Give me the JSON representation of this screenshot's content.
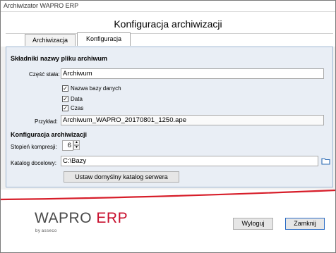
{
  "window": {
    "title": "Archiwizator WAPRO ERP"
  },
  "header": {
    "title": "Konfiguracja archiwizacji"
  },
  "tabs": [
    {
      "label": "Archiwizacja"
    },
    {
      "label": "Konfiguracja"
    }
  ],
  "filename_section": {
    "heading": "Składniki nazwy pliku archiwum",
    "constant_label": "Część stała:",
    "constant_value": "Archiwum",
    "db_name_label": "Nazwa bazy danych",
    "db_name_checked": true,
    "date_label": "Data",
    "date_checked": true,
    "time_label": "Czas",
    "time_checked": true,
    "example_label": "Przykład:",
    "example_value": "Archiwum_WAPRO_20170801_1250.ape"
  },
  "archive_config": {
    "heading": "Konfiguracja archiwizacji",
    "compression_label": "Stopień kompresji:",
    "compression_value": "6",
    "target_dir_label": "Katalog docelowy:",
    "target_dir_value": "C:\\Bazy",
    "default_dir_button": "Ustaw domyślny katalog serwera"
  },
  "footer": {
    "logo_main": "WAPRO",
    "logo_erp": "ERP",
    "logo_by": "by",
    "logo_brand": "asseco",
    "logout_button": "Wyloguj",
    "close_button": "Zamknij"
  },
  "icons": {
    "folder": "folder-icon",
    "spin_up": "chevron-up-icon",
    "spin_down": "chevron-down-icon"
  }
}
